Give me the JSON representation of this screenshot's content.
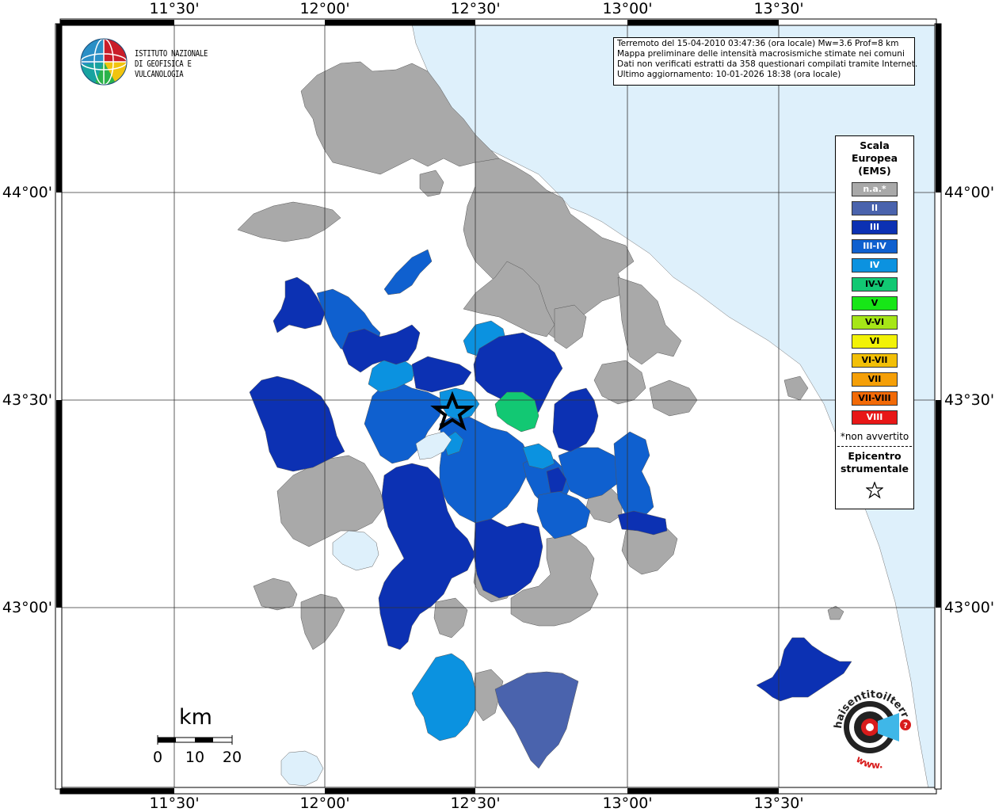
{
  "map": {
    "top_labels": [
      "11°30'",
      "12°00'",
      "12°30'",
      "13°00'",
      "13°30'"
    ],
    "bottom_labels": [
      "11°30'",
      "12°00'",
      "12°30'",
      "13°00'",
      "13°30'"
    ],
    "left_labels": [
      "44°00'",
      "43°30'",
      "43°00'"
    ],
    "right_labels": [
      "44°00'",
      "43°30'",
      "43°00'"
    ],
    "colors": {
      "sea": "#def0fb",
      "gray": "#a9a9a9",
      "ii": "#4a63ad",
      "iii": "#0c31b3",
      "iii_iv": "#0f60cf",
      "iv": "#0b92e0",
      "iv_v": "#12c873",
      "lake": "#def0fb"
    }
  },
  "logo": {
    "line1": "ISTITUTO NAZIONALE",
    "line2": "DI GEOFISICA E VULCANOLOGIA",
    "icon": "ingv-globe-icon"
  },
  "info": {
    "line1": "Terremoto del 15-04-2010 03:47:36 (ora locale) Mw=3.6 Prof=8 km",
    "line2": "Mappa preliminare delle intensità macrosismiche stimate nei comuni",
    "line3": "Dati non verificati estratti da 358 questionari compilati tramite Internet.",
    "line4": "Ultimo aggiornamento: 10-01-2026 18:38 (ora locale)"
  },
  "legend": {
    "title1": "Scala",
    "title2": "Europea",
    "title3": "(EMS)",
    "items": [
      {
        "label": "n.a.*",
        "color": "#a9a9a9",
        "text": "#ffffff"
      },
      {
        "label": "II",
        "color": "#4a63ad",
        "text": "#ffffff"
      },
      {
        "label": "III",
        "color": "#0c31b3",
        "text": "#ffffff"
      },
      {
        "label": "III-IV",
        "color": "#0f60cf",
        "text": "#ffffff"
      },
      {
        "label": "IV",
        "color": "#0b92e0",
        "text": "#ffffff"
      },
      {
        "label": "IV-V",
        "color": "#12c873",
        "text": "#000000"
      },
      {
        "label": "V",
        "color": "#17e617",
        "text": "#000000"
      },
      {
        "label": "V-VI",
        "color": "#a6e617",
        "text": "#000000"
      },
      {
        "label": "VI",
        "color": "#f2f207",
        "text": "#000000"
      },
      {
        "label": "VI-VII",
        "color": "#f2bf07",
        "text": "#000000"
      },
      {
        "label": "VII",
        "color": "#f59f07",
        "text": "#000000"
      },
      {
        "label": "VII-VIII",
        "color": "#f26a07",
        "text": "#000000"
      },
      {
        "label": "VIII",
        "color": "#e81717",
        "text": "#ffffff"
      }
    ],
    "note": "*non avvertito",
    "epi1": "Epicentro",
    "epi2": "strumentale",
    "epi_icon": "star-icon"
  },
  "scale": {
    "unit": "km",
    "ticks": [
      "0",
      "10",
      "20"
    ]
  },
  "watermark": {
    "text_main": "haisentitoilterremoto.it",
    "text_www": "www.",
    "icon": "haisentito-target-icon"
  }
}
